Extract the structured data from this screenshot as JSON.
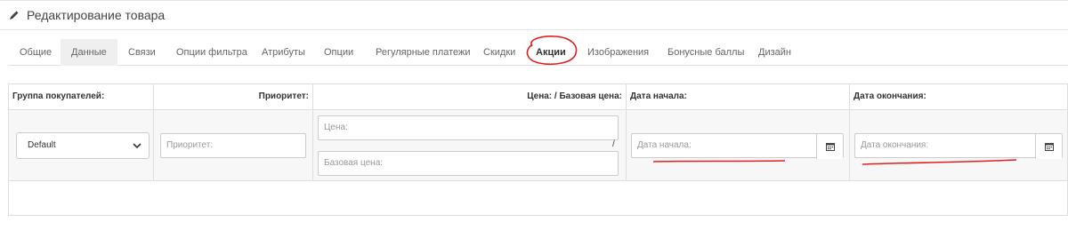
{
  "header": {
    "title": "Редактирование товара",
    "icon": "pencil-icon"
  },
  "tabs": [
    {
      "label": "Общие"
    },
    {
      "label": "Данные"
    },
    {
      "label": "Связи"
    },
    {
      "label": "Опции фильтра"
    },
    {
      "label": "Атрибуты"
    },
    {
      "label": "Опции"
    },
    {
      "label": "Регулярные платежи"
    },
    {
      "label": "Скидки"
    },
    {
      "label": "Акции"
    },
    {
      "label": "Изображения"
    },
    {
      "label": "Бонусные баллы"
    },
    {
      "label": "Дизайн"
    }
  ],
  "table": {
    "headers": {
      "group": "Группа покупателей:",
      "priority": "Приоритет:",
      "price": "Цена: / Базовая цена:",
      "date_start": "Дата начала:",
      "date_end": "Дата окончания:"
    },
    "row": {
      "group_value": "Default",
      "priority_placeholder": "Приоритет:",
      "price_placeholder": "Цена:",
      "separator": "/",
      "base_price_placeholder": "Базовая цена:",
      "date_start_placeholder": "Дата начала:",
      "date_end_placeholder": "Дата окончания:"
    }
  },
  "colors": {
    "annotation": "#e02020",
    "active_tab_bg": "#efefef",
    "border": "#dedede"
  }
}
